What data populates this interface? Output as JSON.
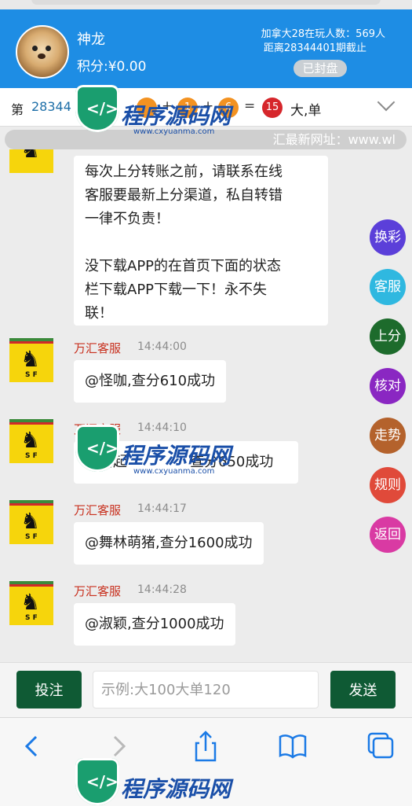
{
  "header": {
    "username": "神龙",
    "score": "积分:¥0.00",
    "game_line1": "加拿大28在玩人数：569人",
    "game_line2": "距离28344401期截止",
    "status_badge": "已封盘"
  },
  "result_bar": {
    "prefix": "第",
    "issue": "28344",
    "balls": [
      "",
      "1",
      "6",
      "15"
    ],
    "plus": "+",
    "equals": "=",
    "result_text": "大,单"
  },
  "notice": {
    "text": "汇最新网址：www.wl"
  },
  "messages": [
    {
      "sender": "",
      "time": "",
      "lines": [
        "每次上分转账之前，请联系在线",
        "客服要最新上分渠道，私自转错",
        "一律不负责！",
        "",
        "没下载APP的在首页下面的状态",
        "栏下载APP下载一下！永不失",
        "联！"
      ]
    },
    {
      "sender": "万汇客服",
      "time": "14:44:00",
      "lines": [
        "@怪咖,查分610成功"
      ]
    },
    {
      "sender": "万汇客服",
      "time": "14:44:10",
      "lines": [
        "@抬起",
        "查分650成功"
      ]
    },
    {
      "sender": "万汇客服",
      "time": "14:44:17",
      "lines": [
        "@舞林萌猪,查分1600成功"
      ]
    },
    {
      "sender": "万汇客服",
      "time": "14:44:28",
      "lines": [
        "@淑颖,查分1000成功"
      ]
    }
  ],
  "side_buttons": [
    {
      "label": "换彩",
      "color": "#5b3fd9"
    },
    {
      "label": "客服",
      "color": "#2fb8e0"
    },
    {
      "label": "上分",
      "color": "#1d6b2c"
    },
    {
      "label": "核对",
      "color": "#8a27c2"
    },
    {
      "label": "走势",
      "color": "#b4622c"
    },
    {
      "label": "规则",
      "color": "#e04a3a"
    },
    {
      "label": "返回",
      "color": "#d93aa3"
    }
  ],
  "input_bar": {
    "bet_label": "投注",
    "placeholder": "示例:大100大单120",
    "send_label": "发送"
  },
  "watermark": {
    "title": "程序源码网",
    "url": "www.cxyuanma.com"
  },
  "colors": {
    "header_bg": "#1e8de4",
    "ball_orange": "#f39221",
    "ball_red": "#d6262b",
    "sender_red": "#c8301e",
    "button_green": "#0f5a34"
  }
}
